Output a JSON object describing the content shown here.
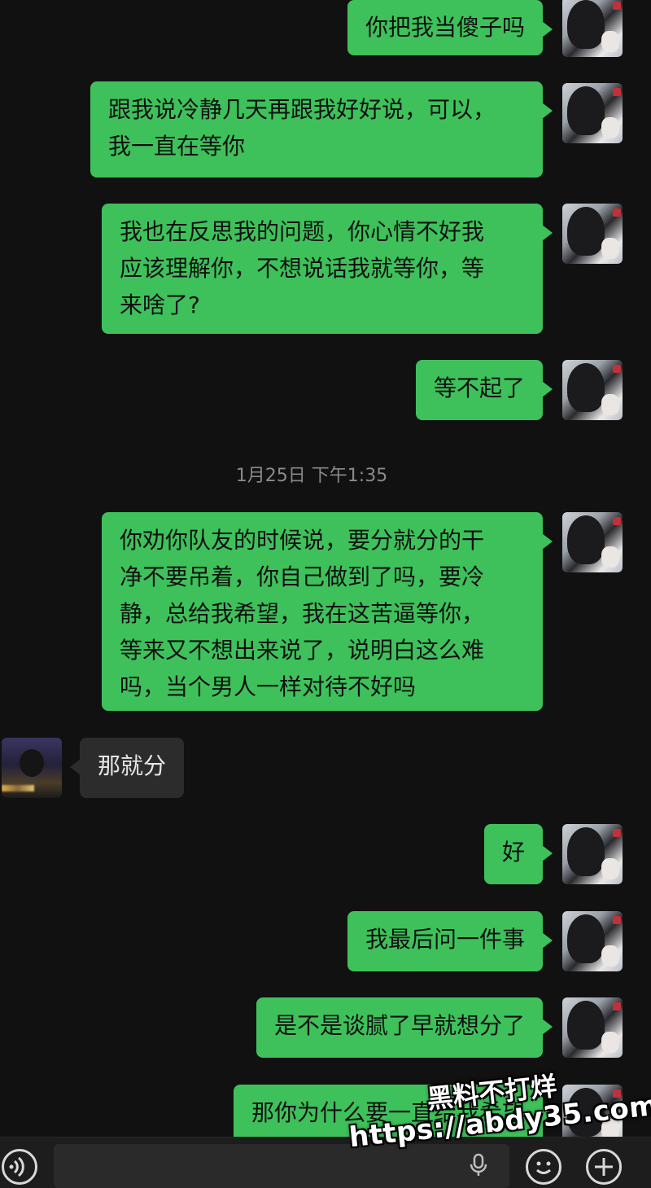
{
  "messages": [
    {
      "side": "out",
      "text": "你把我当傻子吗"
    },
    {
      "side": "out",
      "lines": [
        "跟我说冷静几天再跟我好好说，可以，",
        "我一直在等你"
      ]
    },
    {
      "side": "out",
      "lines": [
        "我也在反思我的问题，你心情不好我",
        "应该理解你，不想说话我就等你，等",
        "来啥了?"
      ]
    },
    {
      "side": "out",
      "text": "等不起了"
    },
    {
      "side": "out",
      "lines": [
        "你劝你队友的时候说，要分就分的干",
        "净不要吊着，你自己做到了吗，要冷",
        "静，总给我希望，我在这苦逼等你，",
        "等来又不想出来说了，说明白这么难",
        "吗，当个男人一样对待不好吗"
      ]
    },
    {
      "side": "in",
      "text": "那就分"
    },
    {
      "side": "out",
      "text": "好"
    },
    {
      "side": "out",
      "text": "我最后问一件事"
    },
    {
      "side": "out",
      "text": "是不是谈腻了早就想分了"
    },
    {
      "side": "out",
      "text": "那你为什么要一直给我希望"
    }
  ],
  "timestamp": "1月25日 下午1:35",
  "watermark": {
    "line1": "黑料不打烊",
    "line2": "https://abdy35.com"
  },
  "icons": {
    "voice": "voice-icon",
    "mic": "mic-icon",
    "emoji": "emoji-icon",
    "plus": "plus-icon"
  },
  "colors": {
    "outgoing_bubble": "#3ec15a",
    "incoming_bubble": "#2c2c2c",
    "background": "#111111"
  }
}
